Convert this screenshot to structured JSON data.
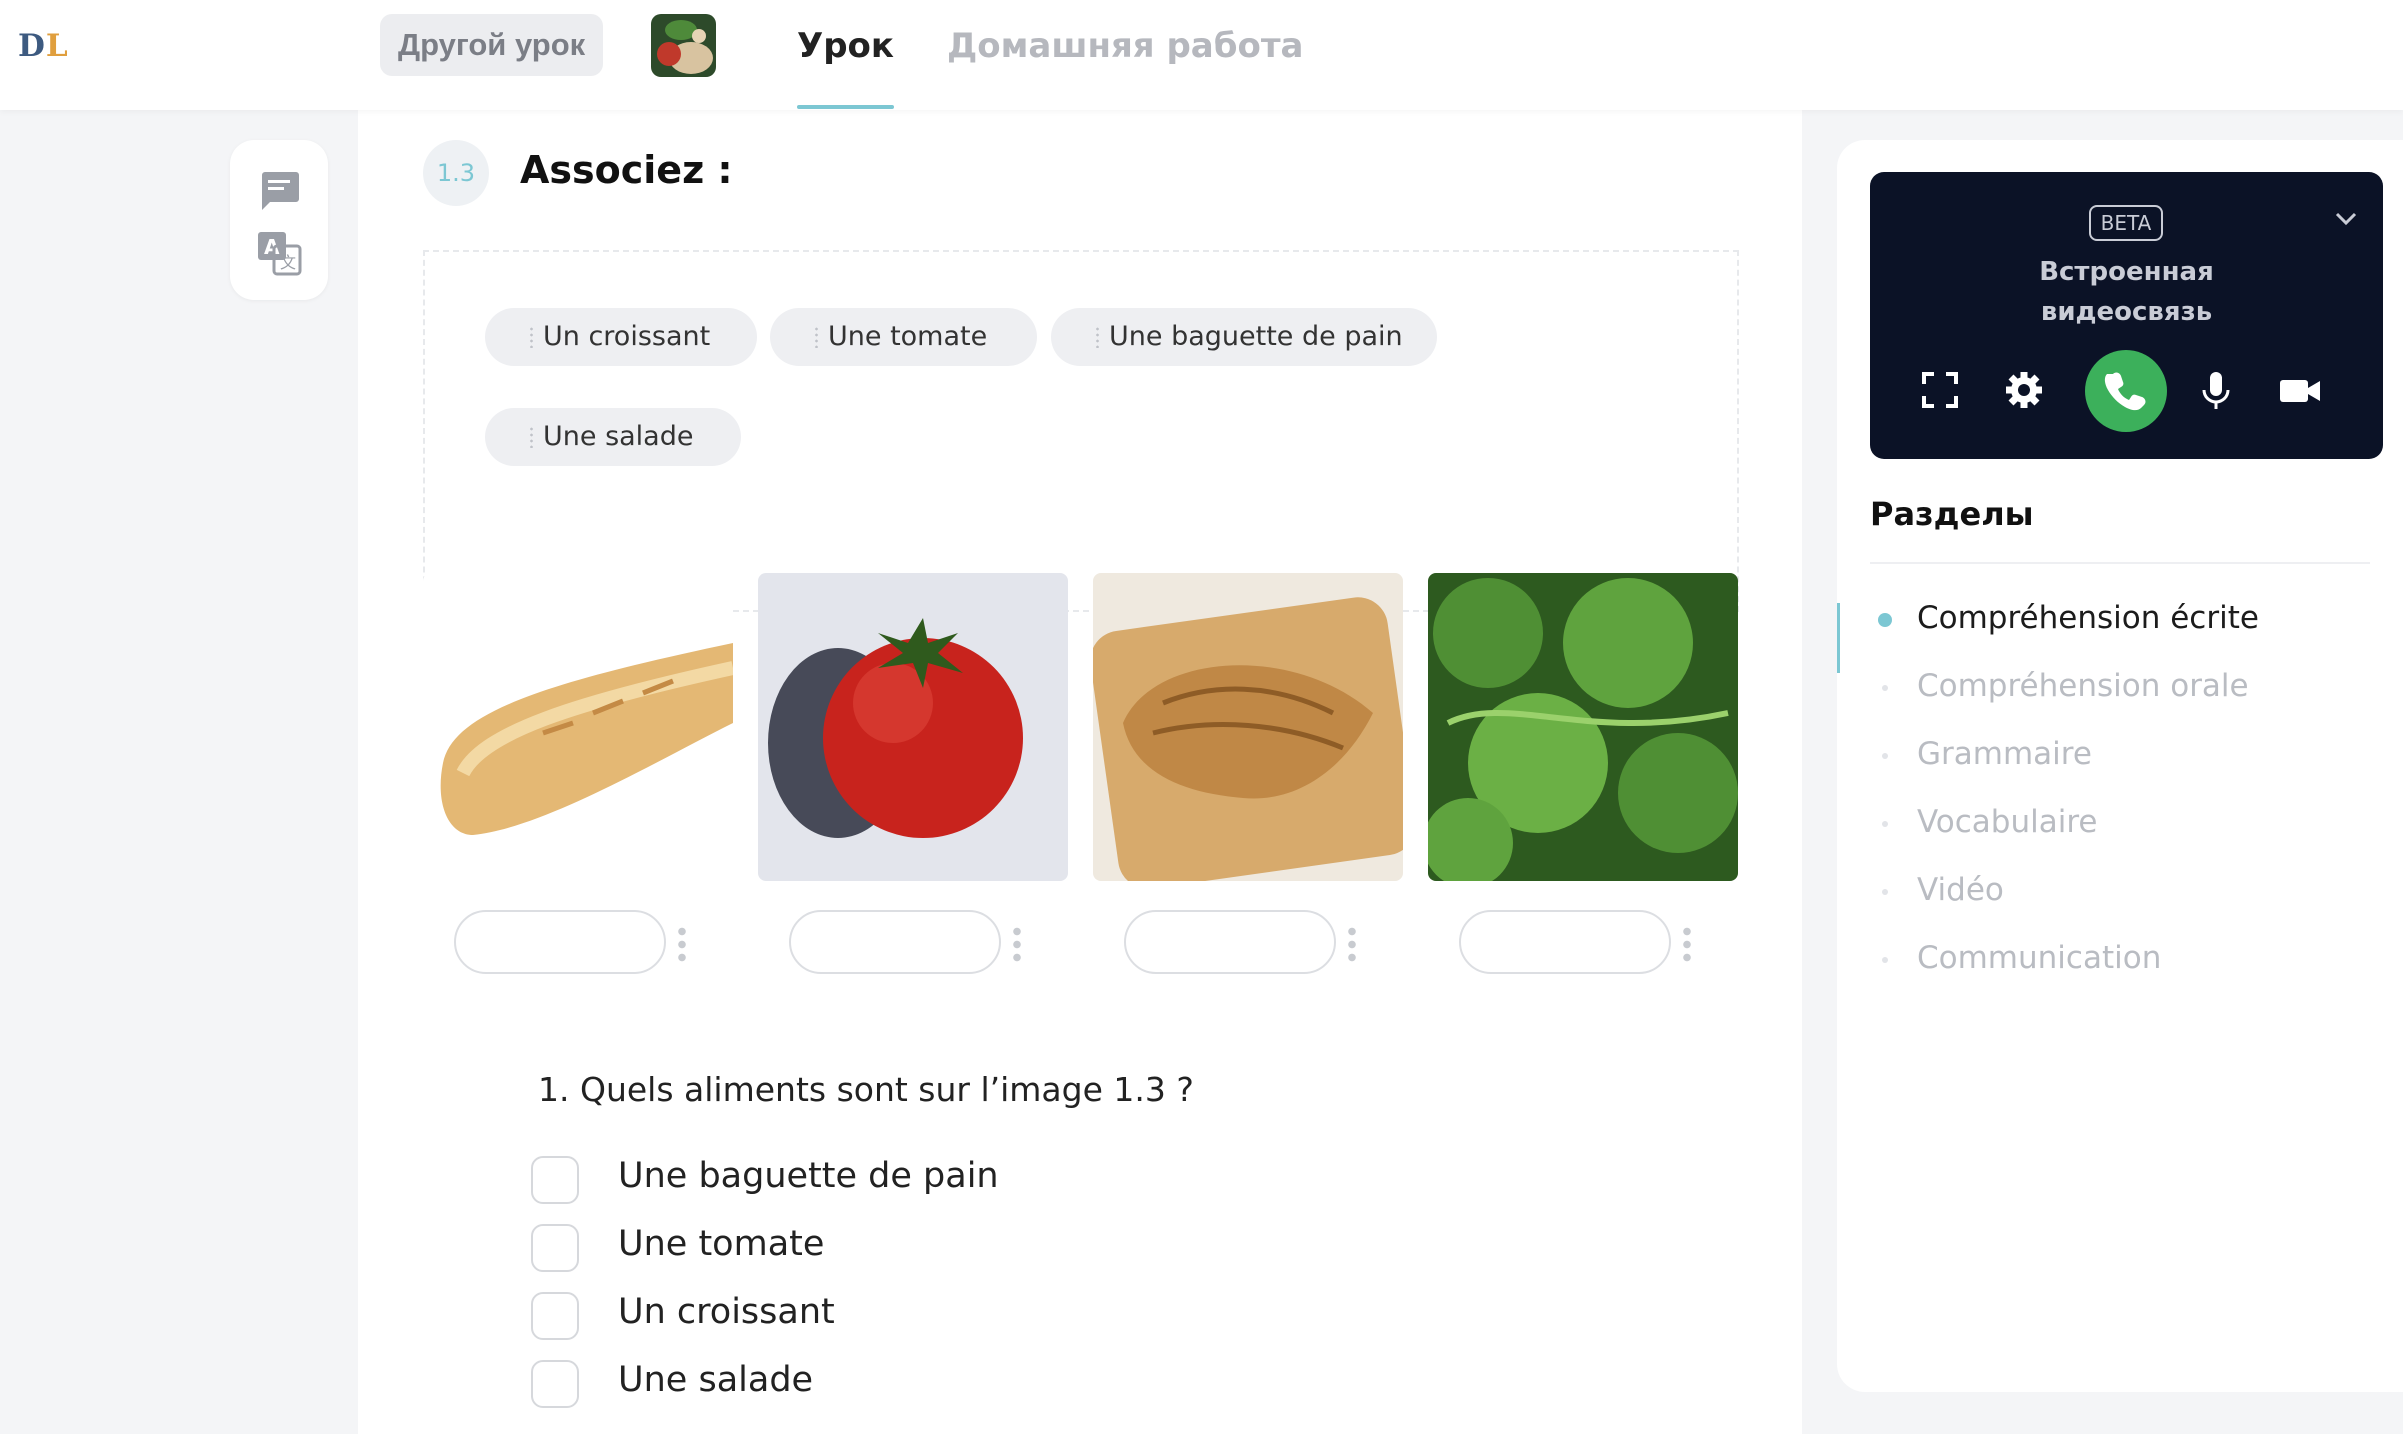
{
  "app": {
    "logo_left": "D",
    "logo_right": "L"
  },
  "header": {
    "other_lesson_button": "Другой урок",
    "tabs": [
      {
        "label": "Урок",
        "active": true
      },
      {
        "label": "Домашняя работа",
        "active": false
      }
    ]
  },
  "exercise": {
    "number": "1.3",
    "title": "Associez :",
    "word_bank": [
      "Un croissant",
      "Une tomate",
      "Une baguette de pain",
      "Une salade"
    ],
    "images": [
      {
        "icon": "baguette-image"
      },
      {
        "icon": "tomato-image"
      },
      {
        "icon": "croissant-image"
      },
      {
        "icon": "lettuce-image"
      }
    ]
  },
  "question": {
    "text": "1. Quels aliments sont sur l’image 1.3 ?",
    "options": [
      "Une baguette de pain",
      "Une tomate",
      "Un croissant",
      "Une salade"
    ]
  },
  "video_call": {
    "badge": "BETA",
    "title_line1": "Встроенная",
    "title_line2": "видеосвязь"
  },
  "sections": {
    "title": "Разделы",
    "items": [
      {
        "label": "Compréhension écrite",
        "active": true
      },
      {
        "label": "Compréhension orale",
        "active": false
      },
      {
        "label": "Grammaire",
        "active": false
      },
      {
        "label": "Vocabulaire",
        "active": false
      },
      {
        "label": "Vidéo",
        "active": false
      },
      {
        "label": "Communication",
        "active": false
      }
    ]
  },
  "colors": {
    "accent": "#7cc7d3",
    "call_green": "#3cb05b",
    "video_bg": "#0b1226"
  }
}
